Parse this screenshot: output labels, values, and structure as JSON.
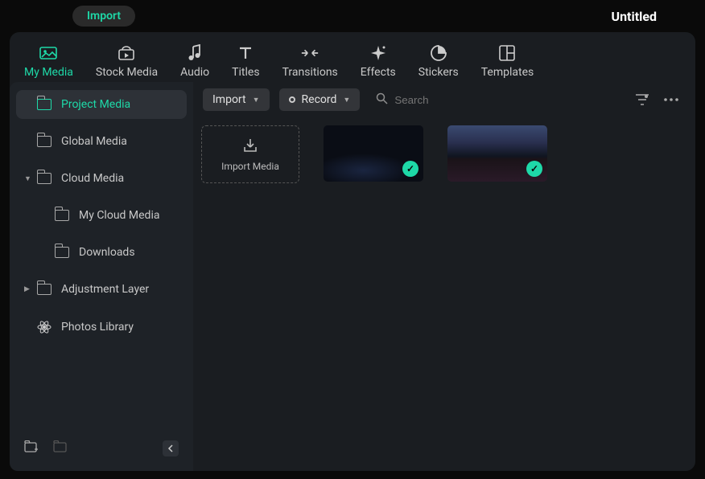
{
  "topbar": {
    "import_label": "Import",
    "project_title": "Untitled"
  },
  "nav_tabs": {
    "my_media": "My Media",
    "stock_media": "Stock Media",
    "audio": "Audio",
    "titles": "Titles",
    "transitions": "Transitions",
    "effects": "Effects",
    "stickers": "Stickers",
    "templates": "Templates"
  },
  "sidebar": {
    "project_media": "Project Media",
    "global_media": "Global Media",
    "cloud_media": "Cloud Media",
    "my_cloud_media": "My Cloud Media",
    "downloads": "Downloads",
    "adjustment_layer": "Adjustment Layer",
    "photos_library": "Photos Library"
  },
  "toolbar": {
    "import_label": "Import",
    "record_label": "Record",
    "search_placeholder": "Search"
  },
  "media_grid": {
    "import_tile_label": "Import Media"
  },
  "accent": "#1ed9a8"
}
